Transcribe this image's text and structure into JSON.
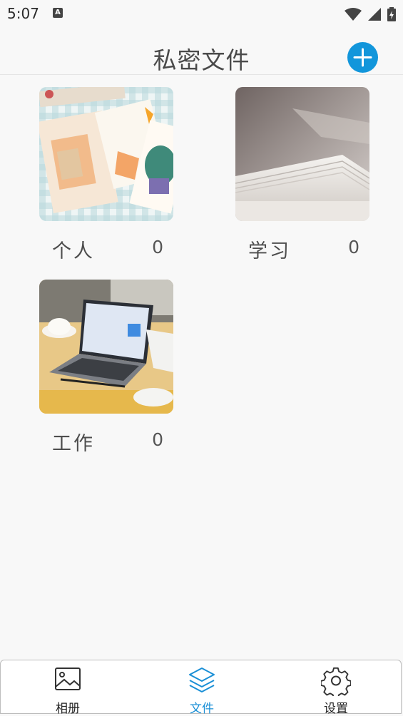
{
  "status_bar": {
    "time": "5:07",
    "notification_icon": "A"
  },
  "header": {
    "title": "私密文件",
    "add_icon": "plus-icon"
  },
  "folders": [
    {
      "name": "个人",
      "count": "0"
    },
    {
      "name": "学习",
      "count": "0"
    },
    {
      "name": "工作",
      "count": "0"
    }
  ],
  "tabbar": {
    "tabs": [
      {
        "label": "相册",
        "icon": "image-icon"
      },
      {
        "label": "文件",
        "icon": "layers-icon"
      },
      {
        "label": "设置",
        "icon": "gear-icon"
      }
    ],
    "active_tab": "文件"
  },
  "colors": {
    "accent": "#1296db",
    "active_tab": "#1a8fd6",
    "background": "#f8f8f8"
  }
}
